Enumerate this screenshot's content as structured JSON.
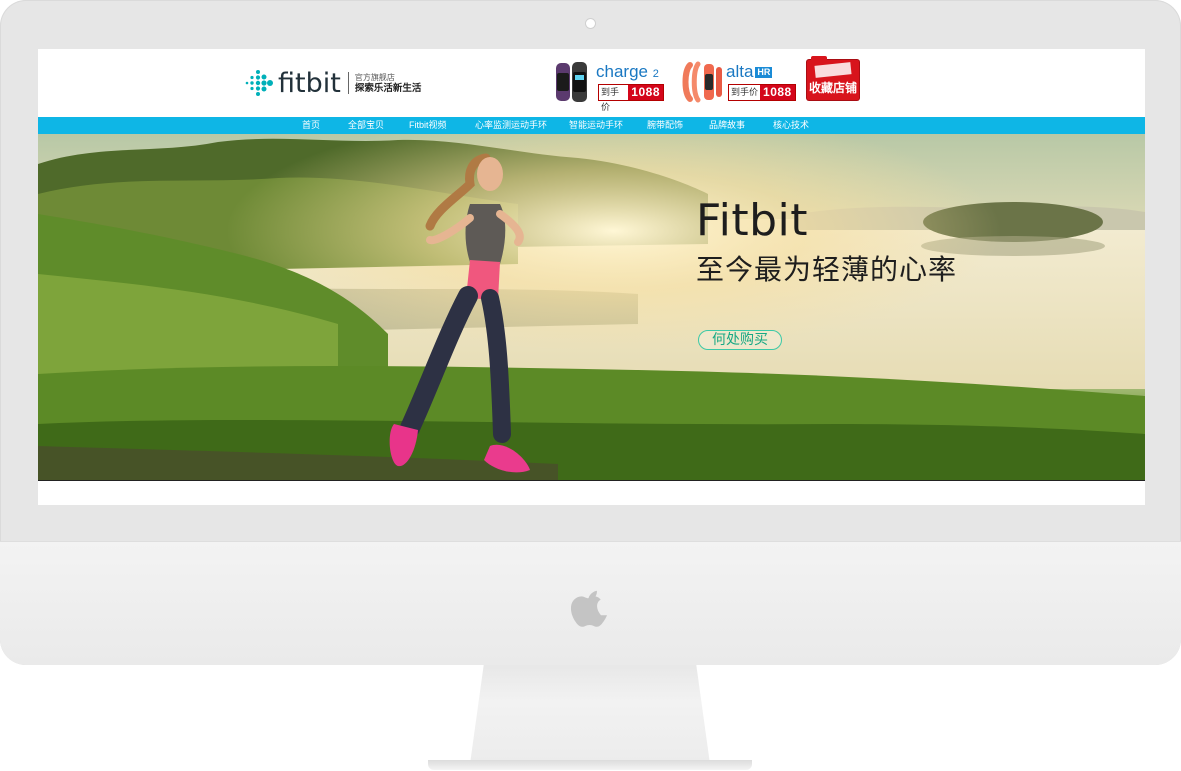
{
  "store": {
    "brand_name": "fitbit",
    "tagline_small": "官方旗舰店",
    "tagline_main": "探索乐活新生活"
  },
  "promos": [
    {
      "name": "charge",
      "suffix": "2",
      "price_label": "到手价",
      "price": "1088"
    },
    {
      "name": "alta",
      "suffix": "HR",
      "price_label": "到手价",
      "price": "1088"
    }
  ],
  "favorite_button": {
    "label": "收藏店铺"
  },
  "nav": {
    "items": [
      "首页",
      "全部宝贝",
      "Fitbit视频",
      "心率监测运动手环",
      "智能运动手环",
      "腕带配饰",
      "品牌故事",
      "核心技术"
    ]
  },
  "hero": {
    "title": "Fitbit",
    "subtitle": "至今最为轻薄的心率",
    "cta": "何处购买"
  },
  "colors": {
    "nav_bar": "#0eb6e6",
    "price_red": "#d4061b",
    "brand_teal": "#00b0b9",
    "cta_green": "#3cc9a7",
    "frame_gray": "#e6e6e6"
  },
  "icons": [
    "fitbit-logo-icon",
    "apple-logo-icon",
    "folder-icon"
  ]
}
